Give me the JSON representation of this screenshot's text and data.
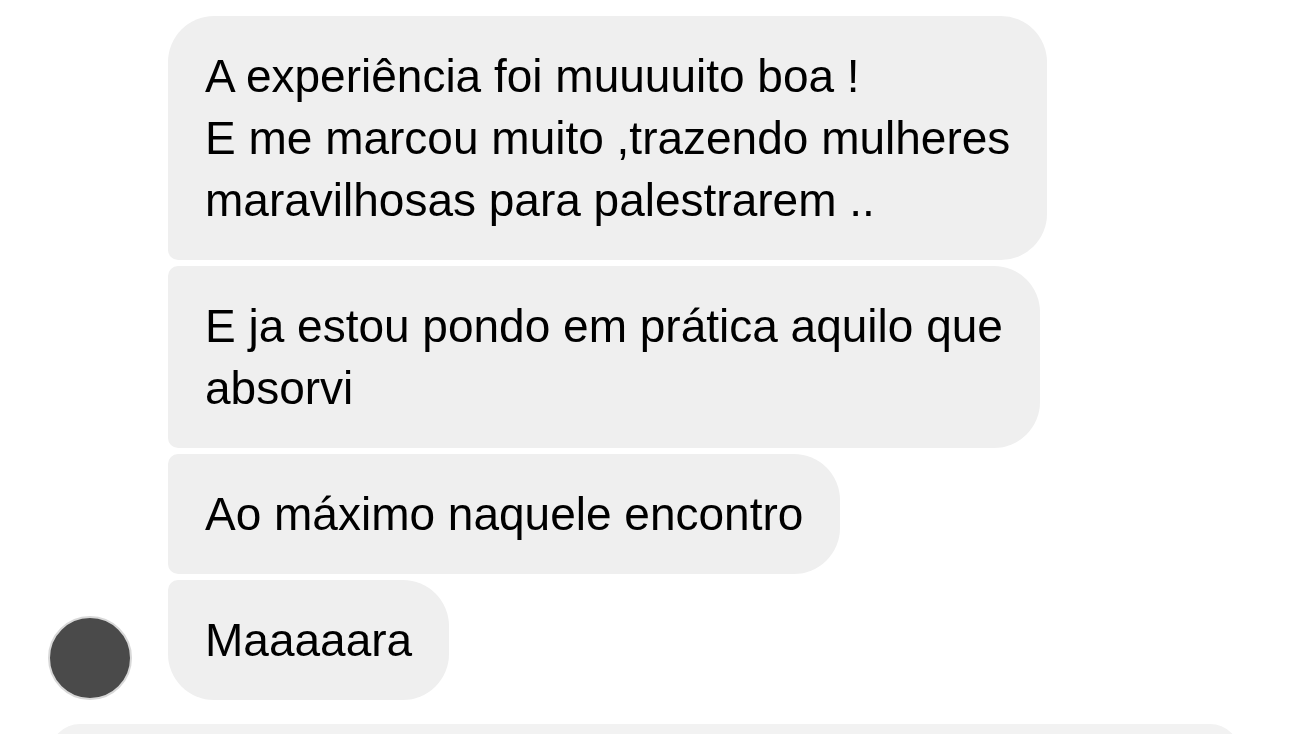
{
  "messages": [
    {
      "text": "A experiência foi muuuuito boa !\nE me marcou muito ,trazendo mulheres\nmaravilhosas para palestrarem ..",
      "avatar": false
    },
    {
      "text": "E ja estou pondo em prática aquilo que\nabsorvi",
      "avatar": false
    },
    {
      "text": "Ao máximo naquele encontro",
      "avatar": false
    },
    {
      "text": "Maaaaara",
      "avatar": true
    }
  ]
}
